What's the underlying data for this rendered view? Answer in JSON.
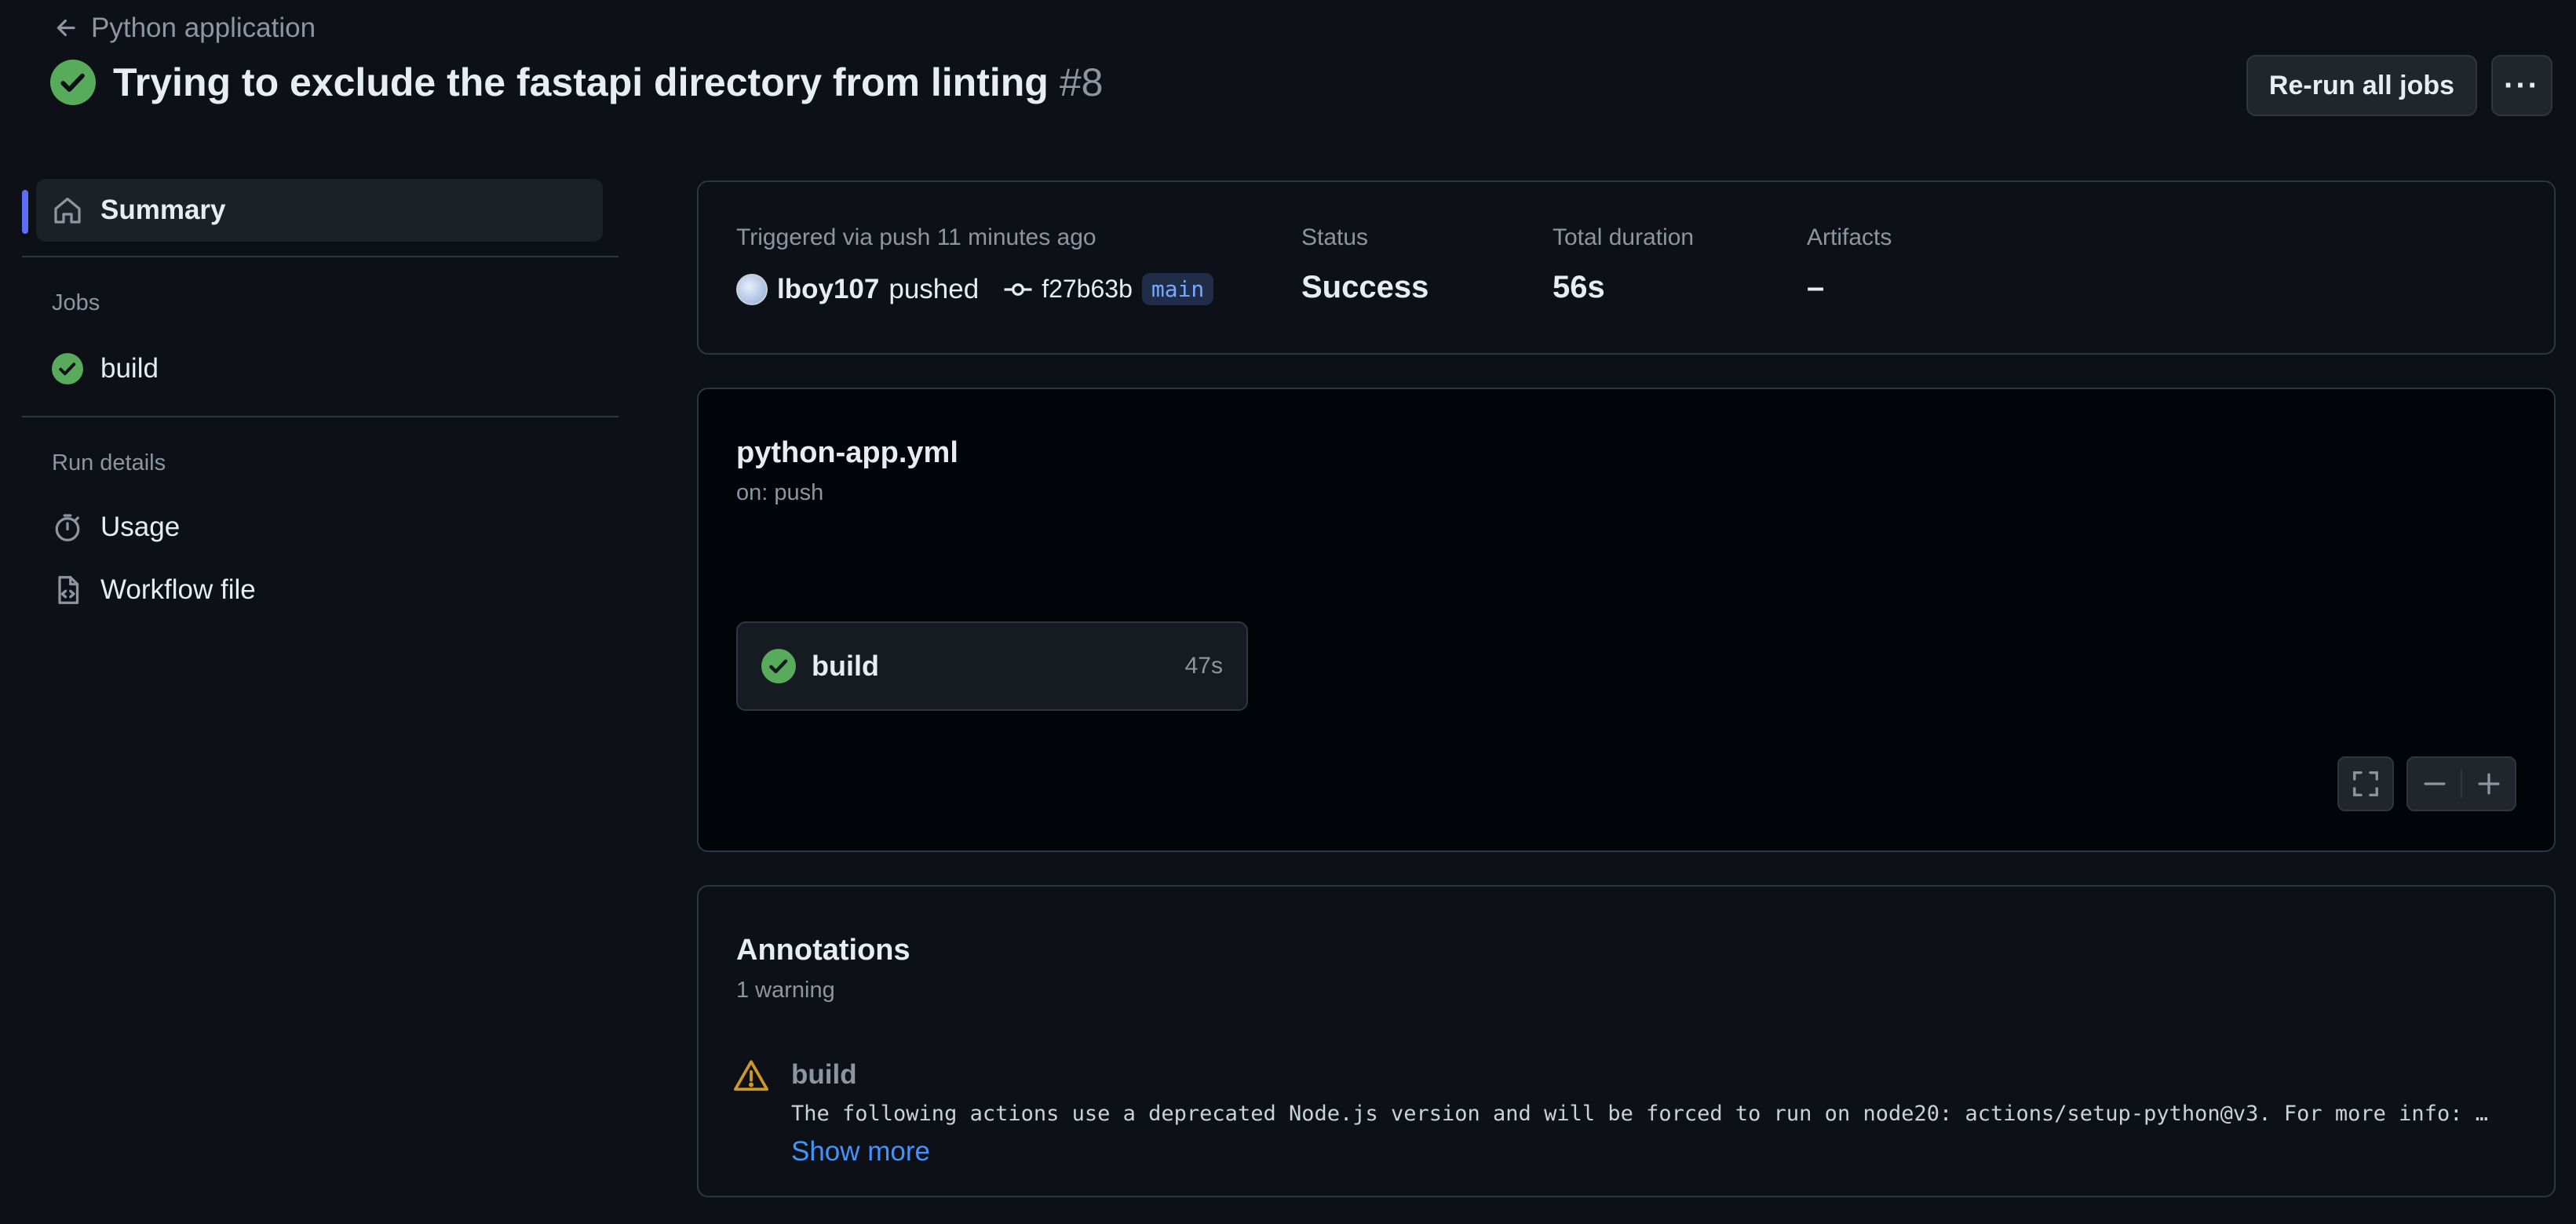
{
  "header": {
    "back_label": "Python application",
    "title": "Trying to exclude the fastapi directory from linting",
    "run_number": "#8",
    "rerun_label": "Re-run all jobs",
    "more_label": "···"
  },
  "sidebar": {
    "summary_label": "Summary",
    "jobs_heading": "Jobs",
    "jobs": [
      {
        "label": "build",
        "status": "success"
      }
    ],
    "run_details_heading": "Run details",
    "usage_label": "Usage",
    "workflow_file_label": "Workflow file"
  },
  "summary": {
    "triggered": "Triggered via push 11 minutes ago",
    "user": "lboy107",
    "action": "pushed",
    "commit": "f27b63b",
    "branch": "main",
    "status_label": "Status",
    "status_value": "Success",
    "duration_label": "Total duration",
    "duration_value": "56s",
    "artifacts_label": "Artifacts",
    "artifacts_value": "–"
  },
  "workflow": {
    "file": "python-app.yml",
    "trigger": "on: push",
    "job_name": "build",
    "job_duration": "47s"
  },
  "annotations": {
    "title": "Annotations",
    "count": "1 warning",
    "job": "build",
    "message": "The following actions use a deprecated Node.js version and will be forced to run on node20: actions/setup-python@v3. For more info: …",
    "show_more": "Show more"
  },
  "colors": {
    "success": "#57ab5a",
    "warning": "#d29922",
    "accent": "#5c6ef8",
    "link": "#4493f8"
  }
}
